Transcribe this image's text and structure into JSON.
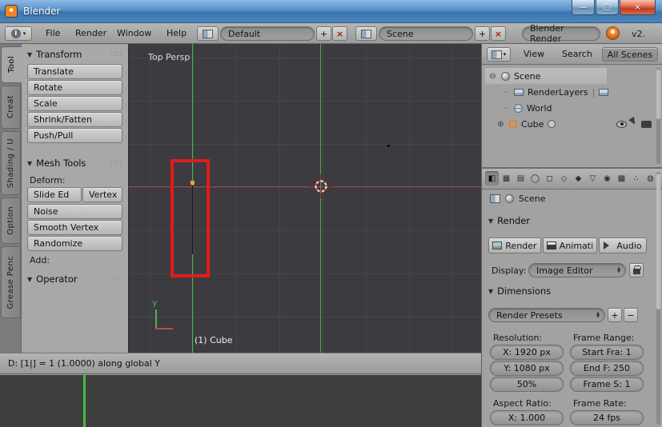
{
  "window": {
    "title": "Blender",
    "minimize_glyph": "—",
    "maximize_glyph": "▢",
    "close_glyph": "×"
  },
  "topbar": {
    "menus": [
      "File",
      "Render",
      "Window",
      "Help"
    ],
    "layout_value": "Default",
    "scene_value": "Scene",
    "engine_value": "Blender Render",
    "version_text": "v2."
  },
  "toolshelf": {
    "tabs": [
      "Tool",
      "Creat",
      "Shading / U",
      "Option",
      "Grease Penc"
    ],
    "transform": {
      "title": "Transform",
      "buttons": [
        "Translate",
        "Rotate",
        "Scale",
        "Shrink/Fatten",
        "Push/Pull"
      ]
    },
    "mesh_tools": {
      "title": "Mesh Tools",
      "deform_label": "Deform:",
      "slide_edge_button": "Slide Ed",
      "vertex_button": "Vertex",
      "buttons": [
        "Noise",
        "Smooth Vertex",
        "Randomize"
      ],
      "add_label": "Add:"
    },
    "operator_title": "Operator"
  },
  "viewport": {
    "view_label": "Top Persp",
    "object_label": "(1) Cube",
    "y_axis_label": "y",
    "header_status": "D: [1|] = 1 (1.0000) along global Y"
  },
  "outliner": {
    "menus": [
      "View",
      "Search"
    ],
    "scope_button": "All Scenes",
    "rows": [
      {
        "label": "Scene",
        "expander": "⊖"
      },
      {
        "label": "RenderLayers"
      },
      {
        "label": "World"
      },
      {
        "label": "Cube",
        "expander": "⊕"
      }
    ]
  },
  "properties": {
    "tabs": [
      {
        "name": "render",
        "glyph": "◧"
      },
      {
        "name": "render-layers",
        "glyph": "▦"
      },
      {
        "name": "scene",
        "glyph": "▤"
      },
      {
        "name": "world",
        "glyph": "◯"
      },
      {
        "name": "object",
        "glyph": "◻"
      },
      {
        "name": "constraints",
        "glyph": "◇"
      },
      {
        "name": "modifiers",
        "glyph": "◆"
      },
      {
        "name": "object-data",
        "glyph": "▽"
      },
      {
        "name": "material",
        "glyph": "◉"
      },
      {
        "name": "texture",
        "glyph": "▩"
      },
      {
        "name": "particles",
        "glyph": "∴"
      },
      {
        "name": "physics",
        "glyph": "◍"
      }
    ],
    "context_label": "Scene",
    "render": {
      "title": "Render",
      "render_button": "Render",
      "animation_button": "Animati",
      "audio_button": "Audio",
      "display_label": "Display:",
      "display_value": "Image Editor"
    },
    "dimensions": {
      "title": "Dimensions",
      "presets_value": "Render Presets",
      "resolution_label": "Resolution:",
      "frame_range_label": "Frame Range:",
      "res_x": "X: 1920 px",
      "res_y": "Y: 1080 px",
      "res_percent": "50%",
      "frame_start": "Start Fra: 1",
      "frame_end": "End F: 250",
      "frame_step": "Frame S: 1",
      "aspect_label": "Aspect Ratio:",
      "frame_rate_label": "Frame Rate:",
      "aspect_x": "X: 1.000",
      "fps": "24 fps"
    }
  },
  "ui": {
    "collapse_glyph": "▼",
    "grip_glyph": "∷∷",
    "plus_glyph": "+",
    "minus_glyph": "−",
    "close_glyph": "×",
    "dropdown_up": "▲",
    "dropdown_down": "▼",
    "browse_down": "▾",
    "info_glyph": "i",
    "dot_glyph": "·",
    "pipe_glyph": "|"
  },
  "colors": {
    "titlebar_blue": "#4a86c0",
    "axis_x_red": "#a04848",
    "axis_y_green": "#55a055",
    "constraint_green": "#44c044",
    "annotation_red": "#e31b1b",
    "vertex_orange": "#ff9d33",
    "timeline_cursor_green": "#3fbf3f"
  }
}
